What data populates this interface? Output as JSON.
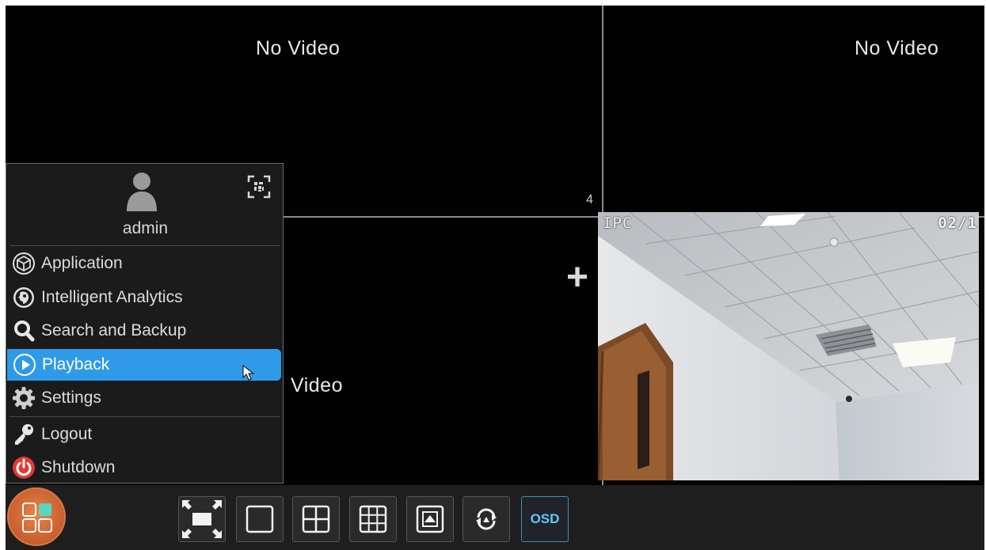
{
  "tiles": {
    "top_left_status": "No Video",
    "top_right_status": "No Video",
    "bottom_left_status": "Video",
    "top_left_channel": "4"
  },
  "camera": {
    "osd_left": "IPC",
    "osd_right": "02/1"
  },
  "menu": {
    "username": "admin",
    "items": [
      {
        "label": "Application",
        "icon": "cube-icon"
      },
      {
        "label": "Intelligent Analytics",
        "icon": "face-analytics-icon"
      },
      {
        "label": "Search and Backup",
        "icon": "search-icon"
      },
      {
        "label": "Playback",
        "icon": "play-icon",
        "active": true
      },
      {
        "label": "Settings",
        "icon": "gear-icon"
      },
      {
        "label": "Logout",
        "icon": "key-icon"
      },
      {
        "label": "Shutdown",
        "icon": "power-icon"
      }
    ]
  },
  "toolbar": {
    "osd_label": "OSD"
  },
  "colors": {
    "active_item": "#2f9ae8",
    "start_button": "#c85e2d",
    "osd_text": "#5ec8ff"
  }
}
